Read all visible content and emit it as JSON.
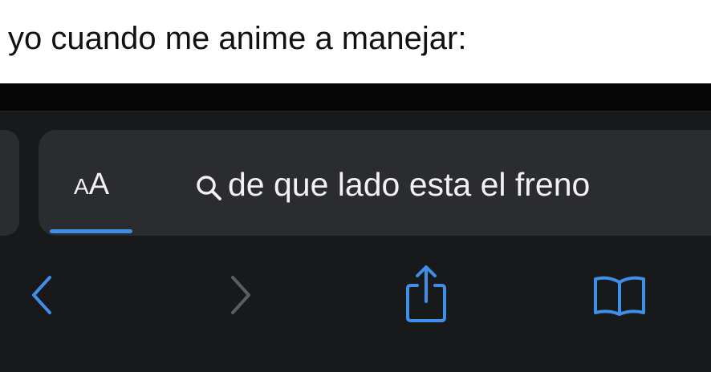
{
  "caption": "yo cuando me anime a manejar:",
  "address_bar": {
    "aa_small": "A",
    "aa_big": "A",
    "search_text": "de que lado esta el freno",
    "progress": 0.12
  },
  "icons": {
    "search": "search-icon",
    "back": "chevron-left-icon",
    "forward": "chevron-right-icon",
    "share": "share-icon",
    "bookmarks": "book-icon"
  },
  "colors": {
    "accent": "#3f8ee8",
    "toolbar_bg": "#18191b",
    "field_bg": "#2b2c2f",
    "disabled_icon": "#5b5d62",
    "text": "#f2f2f2"
  }
}
